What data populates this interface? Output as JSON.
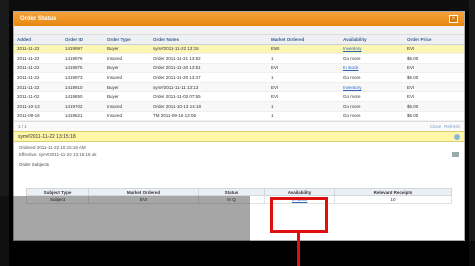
{
  "window": {
    "title": "Order Status"
  },
  "columns": [
    "Added",
    "Order ID",
    "Order Type",
    "Order Notes",
    "Market Ordered",
    "Availability",
    "Order Price"
  ],
  "rows": [
    [
      "2011-11-22",
      "1419997",
      "Buyer",
      "sym#2011-11-22 13:15",
      "EWI",
      "Inventory",
      "EVI"
    ],
    [
      "2011-11-22",
      "1419976",
      "Insured",
      "Order 2011-11-21 13:52",
      "1",
      "Go more",
      "$6.00"
    ],
    [
      "2011-11-22",
      "1419975",
      "Buyer",
      "Order 2011-11-20 13:51",
      "EVI",
      "In stock",
      "EVI"
    ],
    [
      "2011-11-22",
      "1419973",
      "Insured",
      "Order 2011-11-20 13:47",
      "1",
      "Go more",
      "$6.00"
    ],
    [
      "2011-11-22",
      "1419910",
      "Buyer",
      "sym#2011-11-11 13:13",
      "EVI",
      "Inventory",
      "EVI"
    ],
    [
      "2011-11-02",
      "1419850",
      "Buyer",
      "Order 2011-11-02 07:55",
      "EVI",
      "Go more",
      "EVI"
    ],
    [
      "2011-10-13",
      "1419702",
      "Insured",
      "Order 2011-10-13 14:18",
      "1",
      "Go more",
      "$6.00"
    ],
    [
      "2011-09-16",
      "1419621",
      "Insured",
      "TM 2011-09-16 13:06",
      "1",
      "Go more",
      "$6.00"
    ]
  ],
  "pager": {
    "left": "1 / 1",
    "right": [
      "Close",
      "Refresh"
    ]
  },
  "detail": {
    "header": "sym#2011-11-22 13:15:18",
    "line1": "Ordered 2011-11-22 10:15:18 AM",
    "line2": "Effective: sym#2011-11-22 13:15:18 ok"
  },
  "section": {
    "label": "Order Subjects"
  },
  "sub_table": {
    "columns": [
      "Subject Type",
      "Market Ordered",
      "Status",
      "Availability",
      "Relevant Receipts"
    ],
    "rows": [
      [
        "Subject",
        "EVI",
        "In Q",
        "In stock",
        "10"
      ]
    ]
  }
}
